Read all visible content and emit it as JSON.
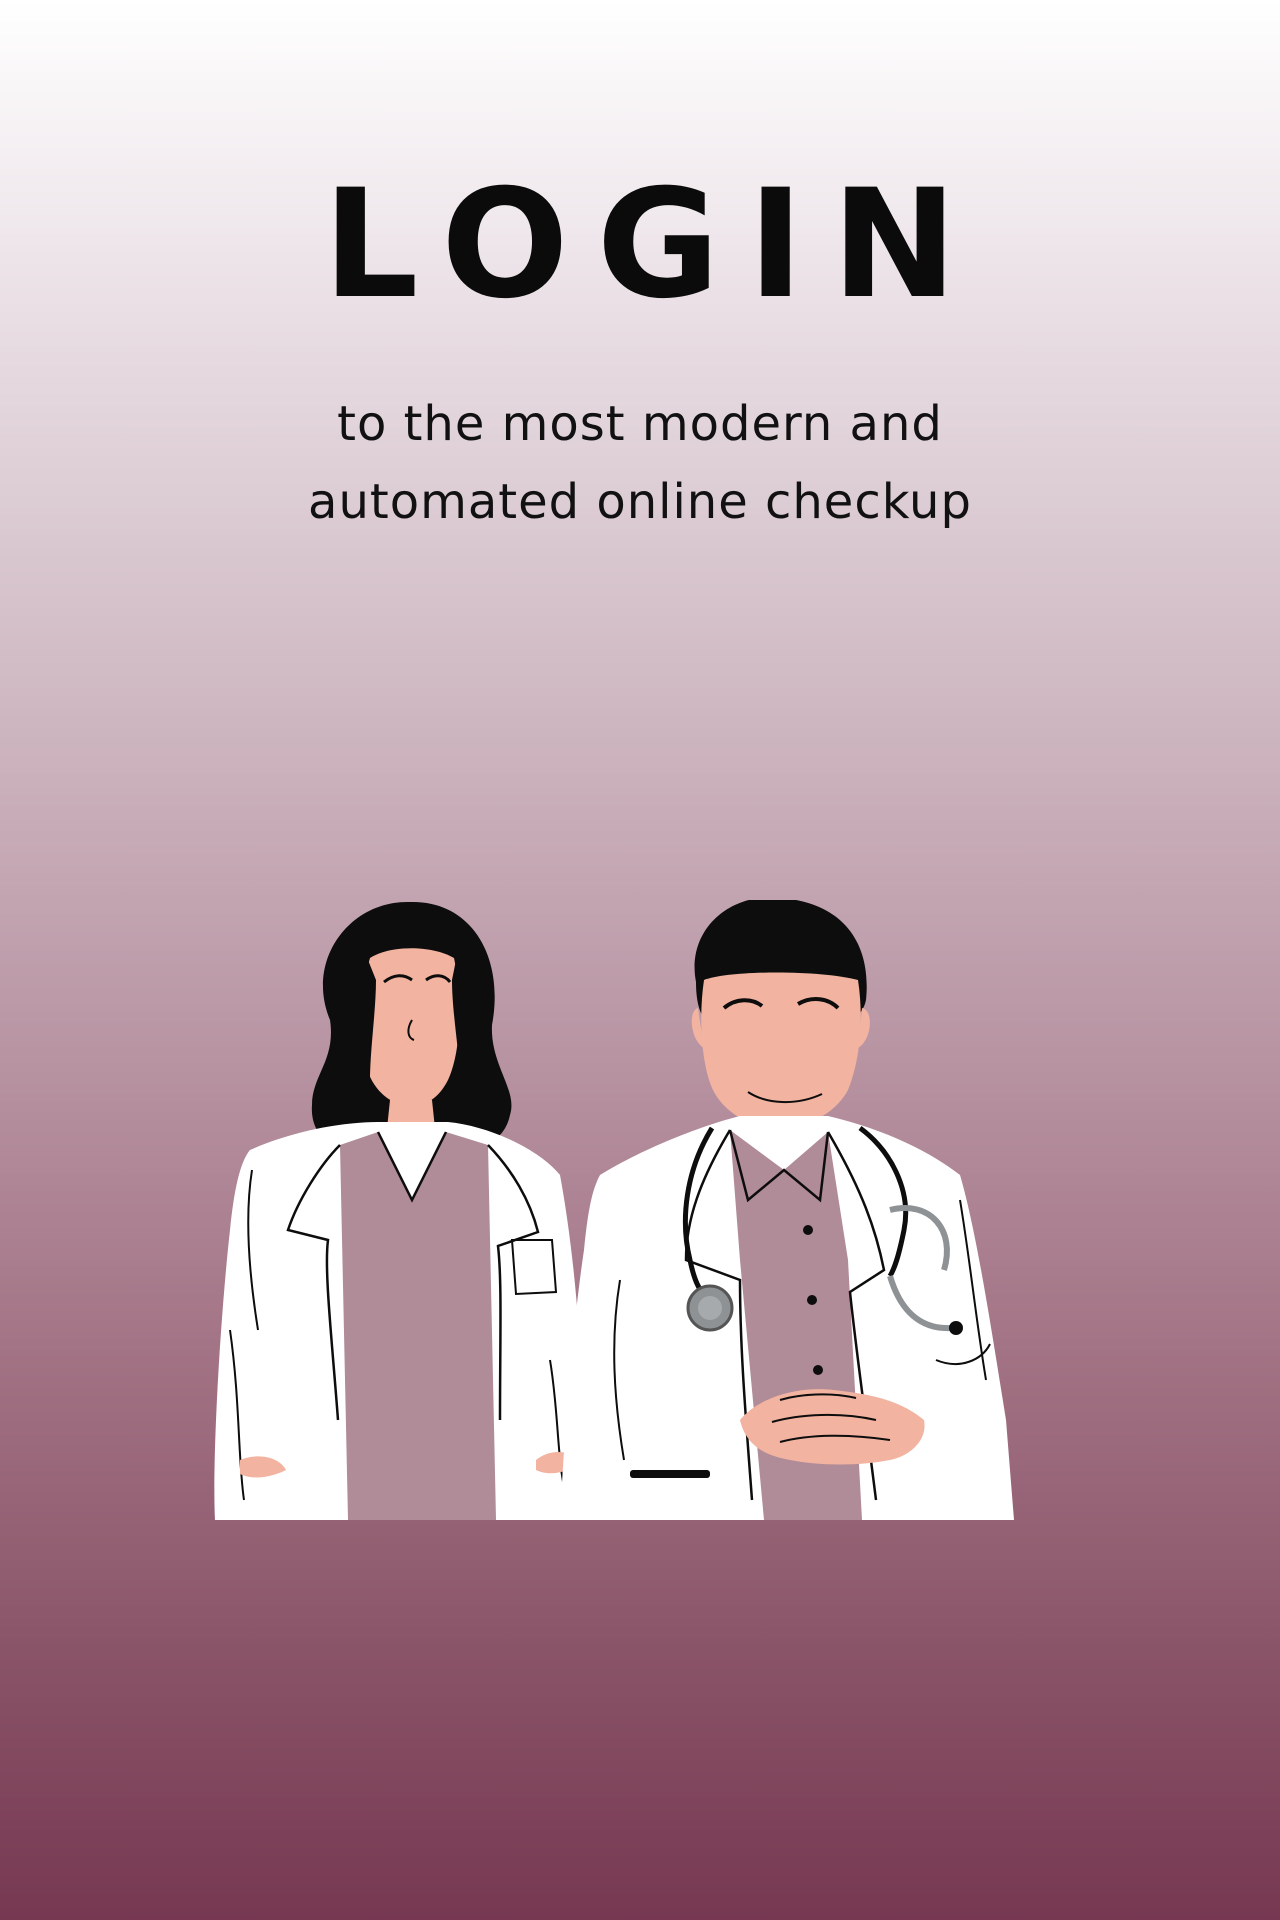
{
  "screen": {
    "title": "LOGIN",
    "subtitle_lines": [
      "to the most modern and",
      "automated online checkup"
    ]
  },
  "illustration": {
    "icon": "doctors-illustration",
    "colors": {
      "skin": "#f2b3a0",
      "hair": "#0d0d0d",
      "coat": "#ffffff",
      "scrubs": "#b08b98",
      "stethoscope": "#8e9294"
    }
  },
  "theme": {
    "gradient_top": "#ffffff",
    "gradient_bottom": "#763851",
    "text_color": "#0b0b0b"
  }
}
